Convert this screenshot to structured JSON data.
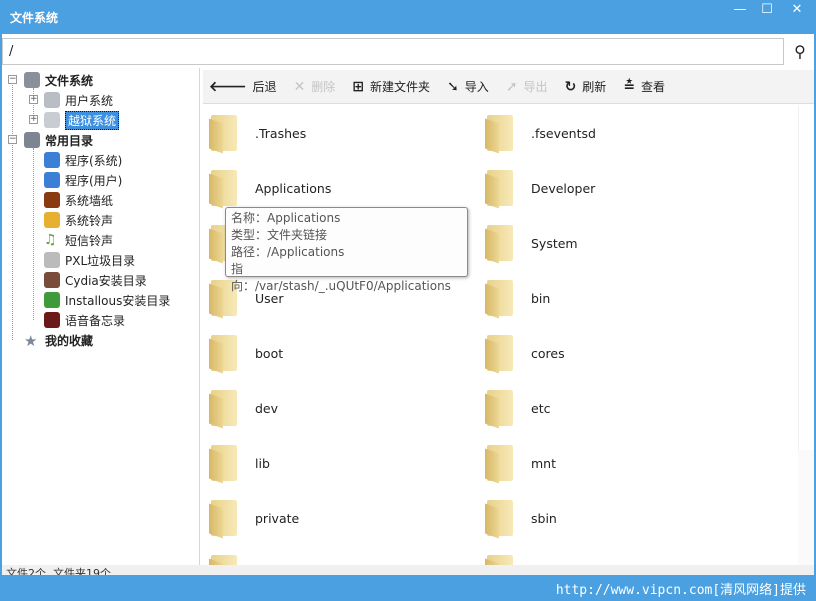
{
  "window": {
    "title": "文件系统",
    "minimize": "—",
    "maximize": "☐",
    "close": "✕"
  },
  "address": {
    "value": "/",
    "search_icon": "search-icon"
  },
  "tree": {
    "root": "文件系统",
    "user_system": "用户系统",
    "jailbreak_system": "越狱系统",
    "common": "常用目录",
    "common_items": [
      "程序(系统)",
      "程序(用户)",
      "系统墙纸",
      "系统铃声",
      "短信铃声",
      "PXL垃圾目录",
      "Cydia安装目录",
      "Installous安装目录",
      "语音备忘录"
    ],
    "favorites": "我的收藏",
    "selected": "越狱系统"
  },
  "toolbar": {
    "back": "后退",
    "delete": "删除",
    "new_folder": "新建文件夹",
    "import": "导入",
    "export": "导出",
    "refresh": "刷新",
    "view": "查看"
  },
  "files": [
    ".Trashes",
    ".fseventsd",
    "Applications",
    "Developer",
    "",
    "System",
    "User",
    "bin",
    "boot",
    "cores",
    "dev",
    "etc",
    "lib",
    "mnt",
    "private",
    "sbin",
    "",
    ""
  ],
  "tooltip": {
    "name_label": "名称：",
    "name": "Applications",
    "type_label": "类型：",
    "type": "文件夹链接",
    "path_label": "路径：",
    "path": "/Applications",
    "target_label": "指向：",
    "target": "/var/stash/_.uQUtF0/Applications"
  },
  "status": "文件2个, 文件夹19个",
  "footer": "http://www.vipcn.com[清风网络]提供",
  "colors": {
    "titlebar": "#4aa0e0",
    "selection": "#3d8fe0"
  }
}
